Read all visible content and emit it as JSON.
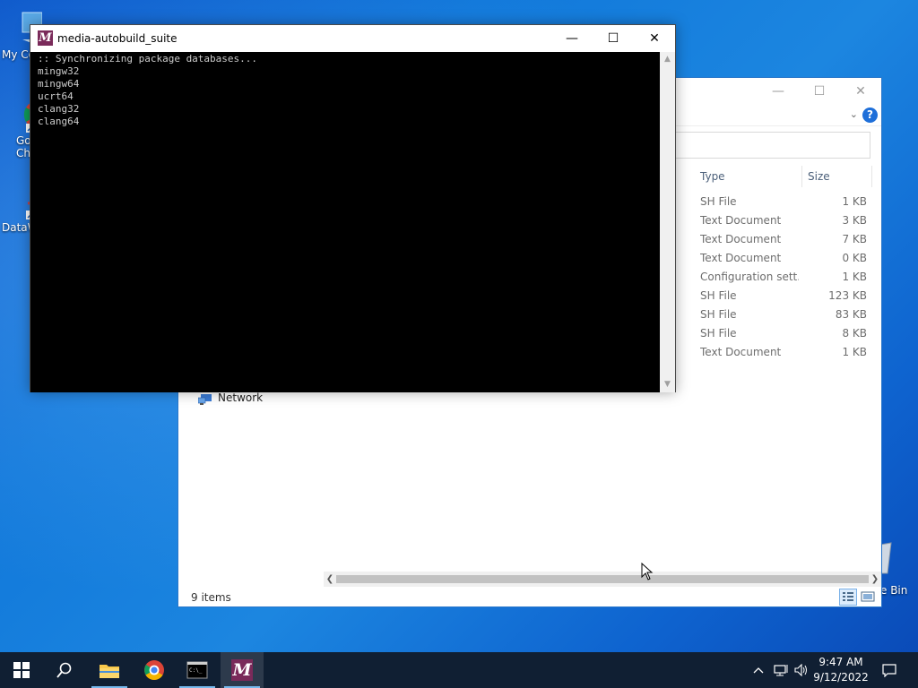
{
  "desktop": {
    "icons": [
      {
        "label": "My Co"
      },
      {
        "label": "Go\nCh"
      },
      {
        "label": "DataW"
      }
    ],
    "recycle_bin_label": "e Bin"
  },
  "explorer": {
    "columns": {
      "type": "Type",
      "size": "Size"
    },
    "rows": [
      {
        "type": "SH File",
        "size": "1 KB"
      },
      {
        "type": "Text Document",
        "size": "3 KB"
      },
      {
        "type": "Text Document",
        "size": "7 KB"
      },
      {
        "type": "Text Document",
        "size": "0 KB"
      },
      {
        "type": "Configuration sett...",
        "size": "1 KB"
      },
      {
        "type": "SH File",
        "size": "123 KB"
      },
      {
        "type": "SH File",
        "size": "83 KB"
      },
      {
        "type": "SH File",
        "size": "8 KB"
      },
      {
        "type": "Text Document",
        "size": "1 KB"
      }
    ],
    "nav_network": "Network",
    "status": "9 items",
    "help": "?"
  },
  "console": {
    "title": "media-autobuild_suite",
    "app_icon_letter": "M",
    "output": ":: Synchronizing package databases...\nmingw32\nmingw64\nucrt64\nclang32\nclang64"
  },
  "taskbar": {
    "time": "9:47 AM",
    "date": "9/12/2022",
    "app_letter": "M"
  },
  "colors": {
    "accent": "#1e6fd9",
    "taskbar": "#101f33",
    "console_icon": "#7a2a5a"
  }
}
